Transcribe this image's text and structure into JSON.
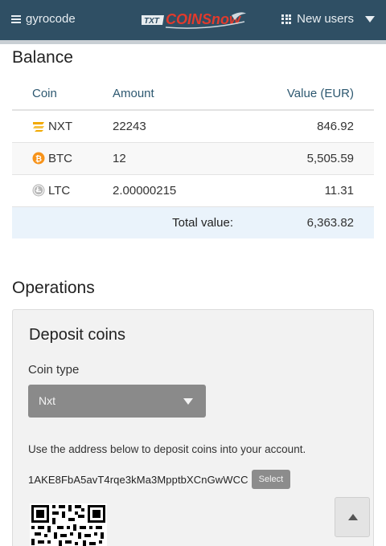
{
  "nav": {
    "menu_label": "gyrocode",
    "brand_prefix": "TXT",
    "brand_name": "COINSnow",
    "users_label": "New users",
    "colors": {
      "bar": "#2f4f64",
      "brand": "#e23a2c"
    }
  },
  "balance": {
    "title": "Balance",
    "columns": [
      "Coin",
      "Amount",
      "Value (EUR)"
    ],
    "rows": [
      {
        "coin": "NXT",
        "icon": "nxt-coin-icon",
        "amount": "22243",
        "value": "846.92"
      },
      {
        "coin": "BTC",
        "icon": "btc-coin-icon",
        "amount": "12",
        "value": "5,505.59"
      },
      {
        "coin": "LTC",
        "icon": "ltc-coin-icon",
        "amount": "2.00000215",
        "value": "11.31"
      }
    ],
    "total_label": "Total value:",
    "total_value": "6,363.82"
  },
  "operations": {
    "title": "Operations",
    "deposit": {
      "title": "Deposit coins",
      "coin_type_label": "Coin type",
      "coin_type_selected": "Nxt",
      "instructions": "Use the address below to deposit coins into your account.",
      "address": "1AKE8FbA5avT4rqe3kMa3MpptbXCnGwWCC",
      "select_label": "Select"
    }
  }
}
